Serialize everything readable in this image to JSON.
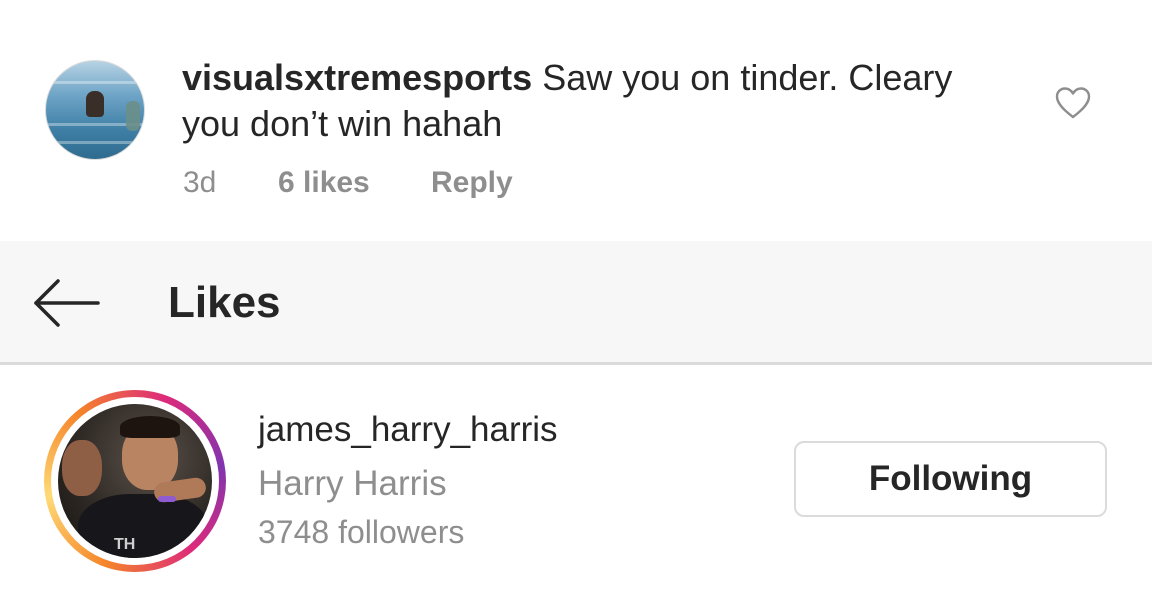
{
  "comment": {
    "username": "visualsxtremesports",
    "text": " Saw you on tinder. Cleary you don’t win hahah",
    "time": "3d",
    "likes": "6 likes",
    "reply_label": "Reply",
    "avatar_icon": "user-avatar-photo",
    "like_icon": "heart-outline-icon"
  },
  "header": {
    "back_icon": "arrow-left-icon",
    "title": "Likes"
  },
  "likes_list": [
    {
      "username": "james_harry_harris",
      "full_name": "Harry Harris",
      "followers": "3748 followers",
      "button_label": "Following",
      "has_story_ring": true,
      "photo_shirt_text": "TH"
    }
  ],
  "colors": {
    "primary_text": "#262626",
    "secondary_text": "#8e8e8e",
    "header_bg": "#f7f7f7",
    "divider": "#dbdbdb",
    "story_ring": [
      "#f58529",
      "#feda77",
      "#dd2a7b",
      "#8134af"
    ]
  }
}
